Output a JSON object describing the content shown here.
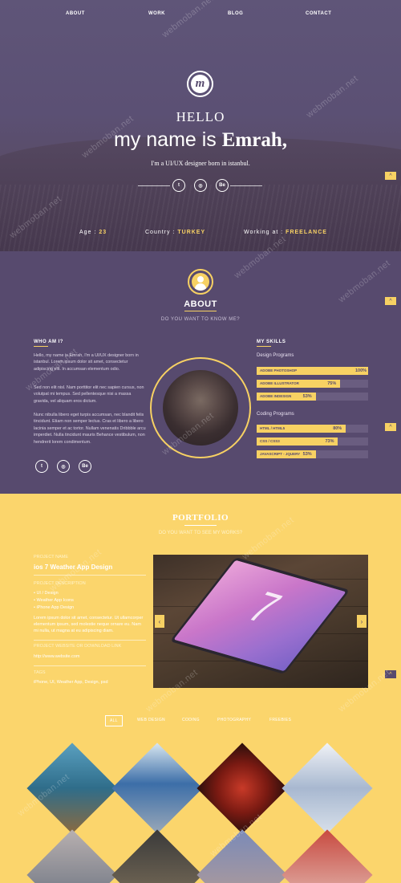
{
  "nav": {
    "items": [
      {
        "label": "ABOUT"
      },
      {
        "label": "WORK"
      },
      {
        "label": "BLOG"
      },
      {
        "label": "CONTACT"
      }
    ]
  },
  "hero": {
    "logo_letter": "m",
    "hello": "HELLO",
    "my_name_is": "my name is ",
    "name": "Emrah,",
    "tagline": "I'm a UI/UX designer born in istanbul.",
    "social": [
      {
        "icon": "twitter-icon",
        "glyph": "t"
      },
      {
        "icon": "dribbble-icon",
        "glyph": "◎"
      },
      {
        "icon": "behance-icon",
        "glyph": "Be"
      }
    ],
    "age_label": "Age :",
    "age_value": "23",
    "country_label": "Country :",
    "country_value": "TURKEY",
    "working_label": "Working at :",
    "working_value": "FREELANCE"
  },
  "about": {
    "title": "ABOUT",
    "subtitle": "DO YOU WANT TO KNOW ME?",
    "who_heading": "WHO AM I?",
    "para1": "Hello, my name is Emrah, I'm a UI/UX designer born in istanbul. Lorem ipsum dolor sit amet, consectetur adipiscing elit. In accumsan elementum odio.",
    "para2": "Sed non elit nisl. Nam porttitor elit nec sapien cursus, non volutpat mi tempus. Sed pellentesque nisi a massa gravida, vel aliquam eros dictum.",
    "para3": "Nunc nibulla libero eget turpis accumsan, nec blandit felis tincidunt. Etiam non semper lectus. Cras et libero a libero lacinia semper et ac tortor. Nullam venenatis Dribbble arcu imperdiet. Nulla tincidunt mauris Behance vestibulum, non hendrerit lorem condimentum.",
    "social": [
      {
        "icon": "twitter-icon",
        "glyph": "t"
      },
      {
        "icon": "dribbble-icon",
        "glyph": "◎"
      },
      {
        "icon": "behance-icon",
        "glyph": "Be"
      }
    ],
    "skills_heading": "MY SKILLS",
    "design_group": "Design Programs",
    "coding_group": "Coding Programs",
    "design_skills": [
      {
        "name": "ADOBE PHOTOSHOP",
        "percent": 100,
        "label": "100%"
      },
      {
        "name": "ADOBE ILLUSTRATOR",
        "percent": 75,
        "label": "75%"
      },
      {
        "name": "ADOBE INDESIGN",
        "percent": 53,
        "label": "53%"
      }
    ],
    "coding_skills": [
      {
        "name": "HTML / HTML5",
        "percent": 80,
        "label": "80%"
      },
      {
        "name": "CSS / CSS3",
        "percent": 73,
        "label": "73%"
      },
      {
        "name": "JAVASCRIPT - JQUERY",
        "percent": 53,
        "label": "53%"
      }
    ]
  },
  "portfolio": {
    "title": "PORTFOLIO",
    "subtitle": "DO YOU WANT TO SEE MY WORKS?",
    "project_label": "PROJECT NAME",
    "project_name": "ios 7 Weather App Design",
    "description_label": "PROJECT DESCRIPTION",
    "bullets": [
      "• UI / Design",
      "• Weather App Icons",
      "• iPhone App Design"
    ],
    "body": "Lorem ipsum dolor sit amet, consectetur. Ut ullamcorper elementum ipsum, sed molestie neque ornare eu. Nam mi nulla, ut magna at eu adipiscing diam.",
    "website_label": "PROJECT WEBSITE OR DOWNLOAD LINK",
    "website": "http://www.website.com",
    "tags_label": "TAGS",
    "tags": "iPhone, UI, Weather App, Design, psd",
    "slider_number": "7",
    "filters": [
      "ALL",
      "WEB DESIGN",
      "CODING",
      "PHOTOGRAPHY",
      "FREEBIES"
    ]
  },
  "watermark": "webmoban.net",
  "colors": {
    "purple": "#574a6e",
    "yellow": "#f7d163",
    "portfolio_bg": "#fbd56c"
  }
}
